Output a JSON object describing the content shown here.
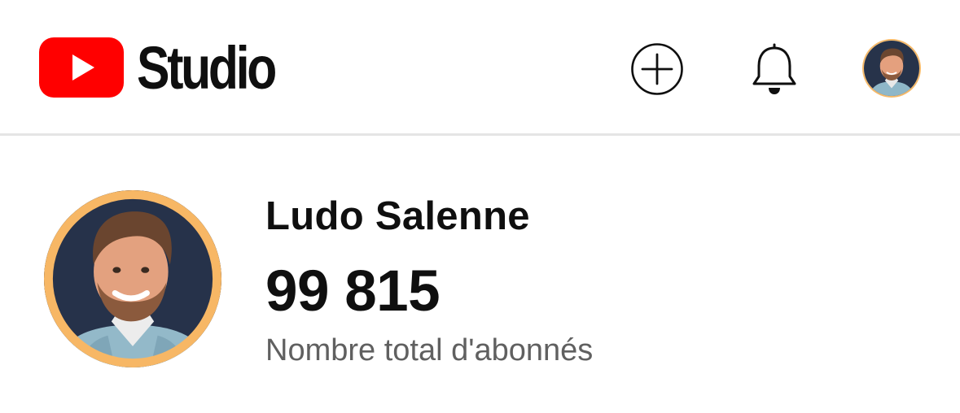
{
  "app": {
    "brand_name": "Studio",
    "brand_color": "#ff0000"
  },
  "header": {
    "actions": [
      {
        "name": "create",
        "icon": "plus-circle-icon"
      },
      {
        "name": "notifications",
        "icon": "bell-icon"
      },
      {
        "name": "account",
        "icon": "avatar"
      }
    ]
  },
  "channel": {
    "name": "Ludo Salenne",
    "subscriber_count": "99 815",
    "subscriber_label": "Nombre total d'abonnés",
    "avatar_ring_color": "#f7b765"
  }
}
